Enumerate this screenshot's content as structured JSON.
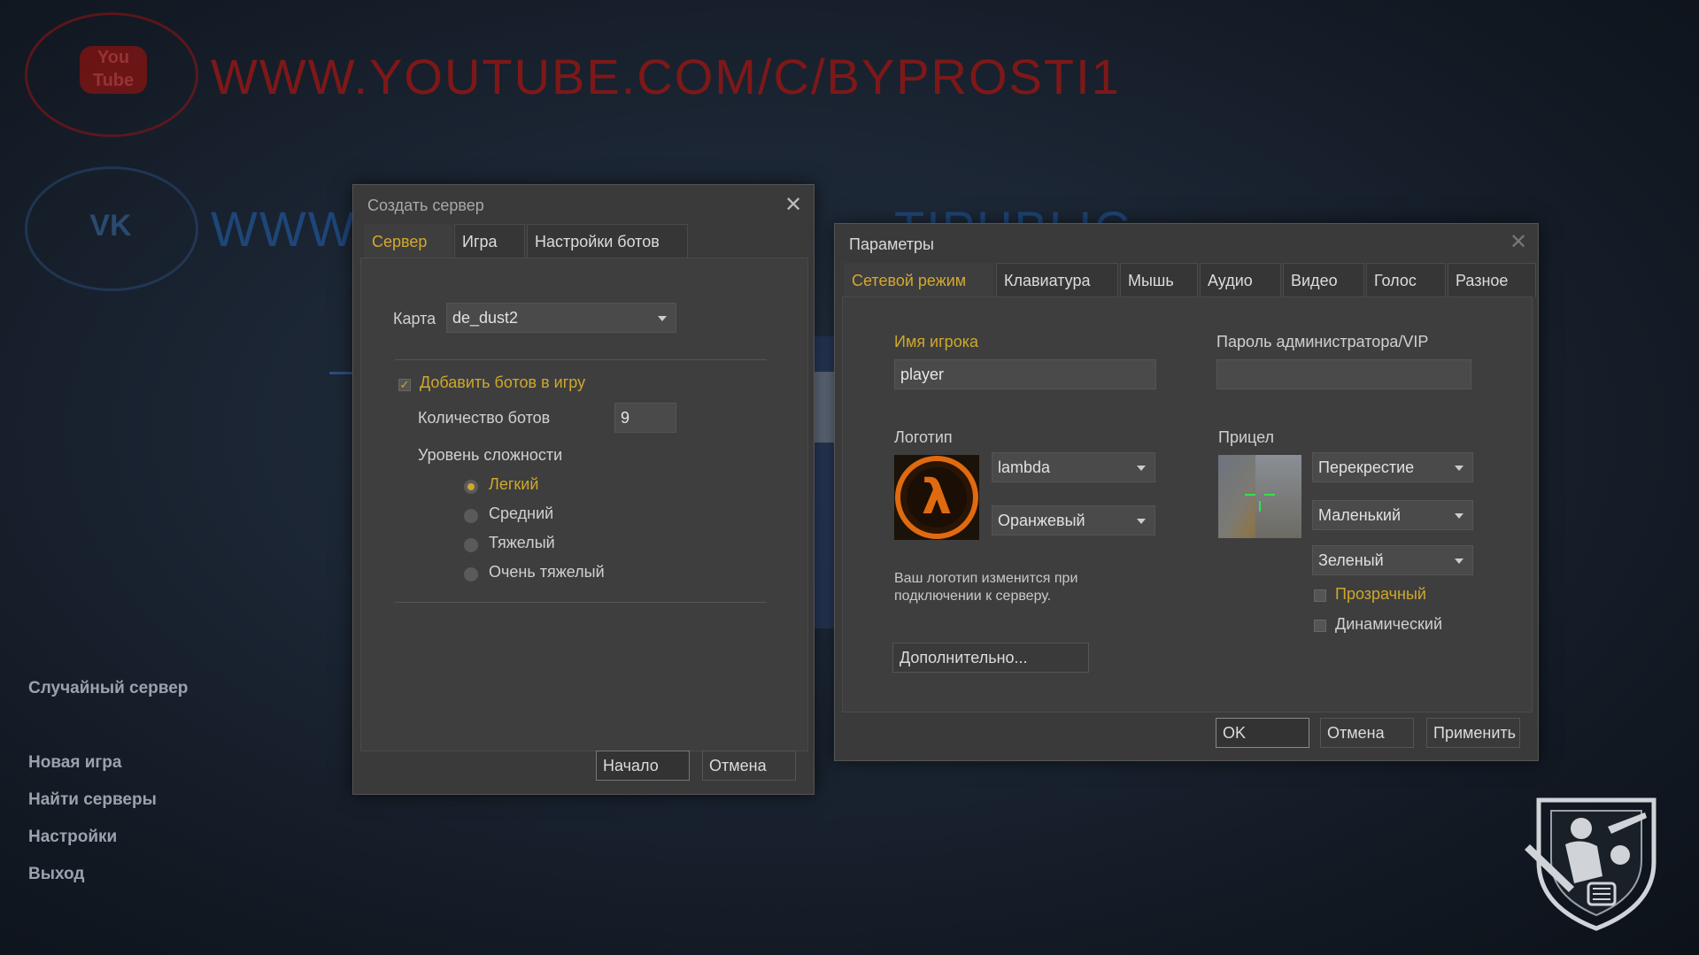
{
  "background": {
    "youtube_url": "WWW.YOUTUBE.COM/C/BYPROSTI1",
    "youtube_logo_text": "You Tube",
    "vk_url": "WWW",
    "vk_url_tail": "TIPUBLIC",
    "vk_logo_text": "VK"
  },
  "main_menu": {
    "items": [
      {
        "label": "Случайный сервер"
      },
      {
        "label": "Новая игра"
      },
      {
        "label": "Найти серверы"
      },
      {
        "label": "Настройки"
      },
      {
        "label": "Выход"
      }
    ]
  },
  "create_server": {
    "title": "Создать сервер",
    "tabs": [
      {
        "label": "Сервер",
        "active": true
      },
      {
        "label": "Игра",
        "active": false
      },
      {
        "label": "Настройки ботов",
        "active": false
      }
    ],
    "map_label": "Карта",
    "map_value": "de_dust2",
    "add_bots_label": "Добавить ботов в игру",
    "add_bots_checked": true,
    "bot_count_label": "Количество ботов",
    "bot_count_value": "9",
    "difficulty_label": "Уровень сложности",
    "difficulties": [
      {
        "label": "Легкий",
        "selected": true
      },
      {
        "label": "Средний",
        "selected": false
      },
      {
        "label": "Тяжелый",
        "selected": false
      },
      {
        "label": "Очень тяжелый",
        "selected": false
      }
    ],
    "start_button": "Начало",
    "cancel_button": "Отмена"
  },
  "parameters": {
    "title": "Параметры",
    "tabs": [
      {
        "label": "Сетевой режим",
        "active": true
      },
      {
        "label": "Клавиатура",
        "active": false
      },
      {
        "label": "Мышь",
        "active": false
      },
      {
        "label": "Аудио",
        "active": false
      },
      {
        "label": "Видео",
        "active": false
      },
      {
        "label": "Голос",
        "active": false
      },
      {
        "label": "Разное",
        "active": false
      }
    ],
    "player_name_label": "Имя игрока",
    "player_name_value": "player",
    "admin_password_label": "Пароль администратора/VIP",
    "admin_password_value": "",
    "logo_label": "Логотип",
    "logo_value": "lambda",
    "logo_color_value": "Оранжевый",
    "logo_note": "Ваш логотип изменится при подключении к серверу.",
    "advanced_button": "Дополнительно...",
    "crosshair_label": "Прицел",
    "crosshair_type": "Перекрестие",
    "crosshair_size": "Маленький",
    "crosshair_color": "Зеленый",
    "transparent_label": "Прозрачный",
    "transparent_checked": false,
    "dynamic_label": "Динамический",
    "dynamic_checked": false,
    "ok_button": "OK",
    "cancel_button": "Отмена",
    "apply_button": "Применить"
  },
  "colors": {
    "accent_gold": "#cfa82b",
    "panel_bg": "#3e3e3e",
    "lambda_orange": "#e06a10"
  }
}
